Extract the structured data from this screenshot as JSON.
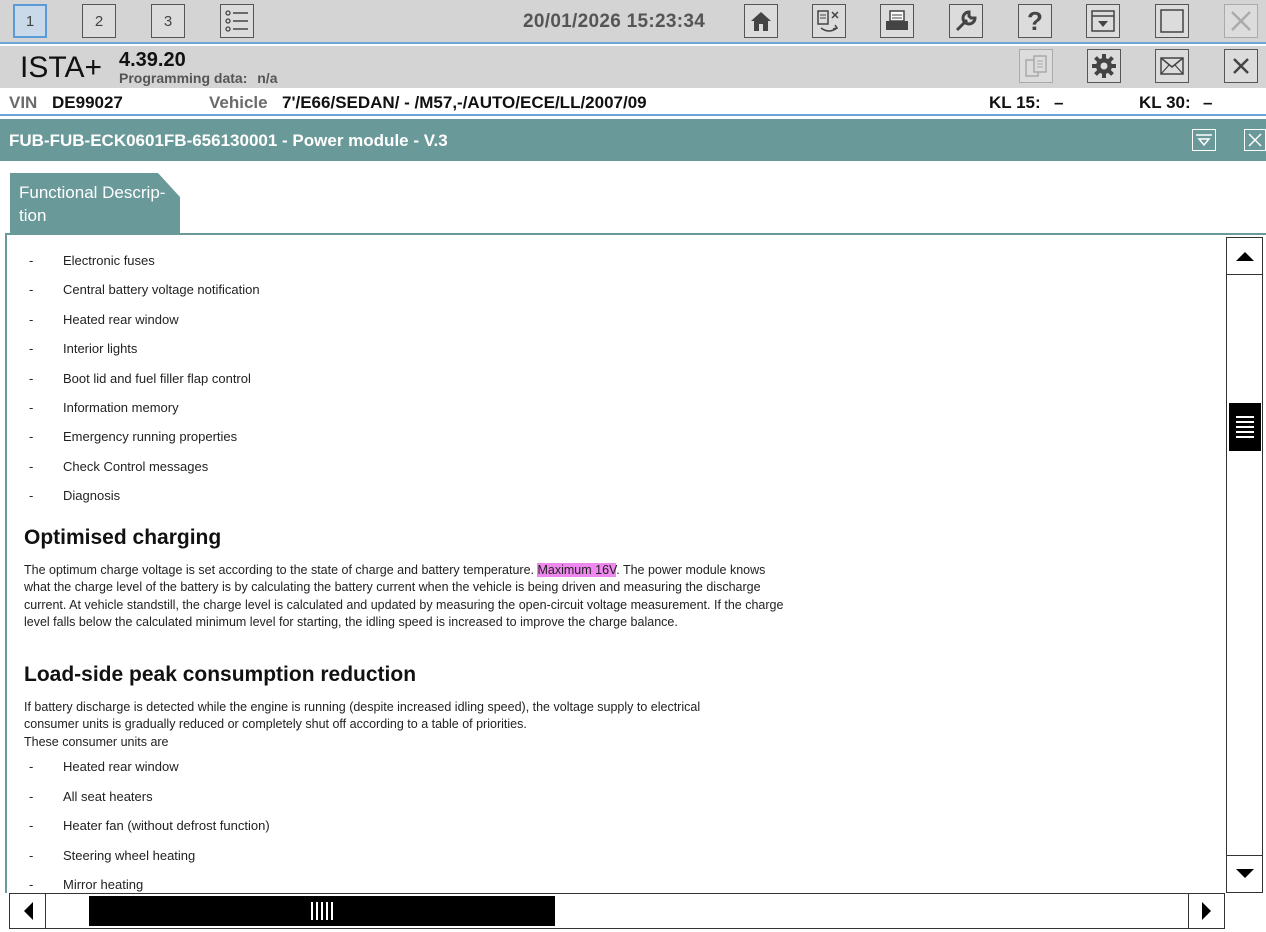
{
  "toolbar": {
    "tabs": [
      "1",
      "2",
      "3"
    ],
    "datetime": "20/01/2026 15:23:34",
    "icons": [
      "list-icon",
      "home-icon",
      "transfer-icon",
      "print-icon",
      "wrench-icon",
      "help-icon",
      "download-icon",
      "window-icon",
      "close-icon"
    ]
  },
  "app": {
    "name": "ISTA+",
    "version": "4.39.20",
    "programming_label": "Programming data:",
    "programming_value": "n/a"
  },
  "vehicle": {
    "vin_label": "VIN",
    "vin_value": "DE99027",
    "vehicle_label": "Vehicle",
    "vehicle_value": "7'/E66/SEDAN/ - /M57,-/AUTO/ECE/LL/2007/09",
    "kl15_label": "KL 15:",
    "kl15_value": "–",
    "kl30_label": "KL 30:",
    "kl30_value": "–"
  },
  "document": {
    "title": "FUB-FUB-ECK0601FB-656130001 - Power module - V.3",
    "tab_label": "Functional Descrip- tion",
    "list1": [
      "Electronic fuses",
      "Central battery voltage notification",
      "Heated rear window",
      "Interior lights",
      "Boot lid and fuel filler flap control",
      "Information memory",
      "Emergency running properties",
      "Check Control messages",
      "Diagnosis"
    ],
    "heading1": "Optimised charging",
    "para1_before": "The optimum charge voltage is set according to the state of charge and battery temperature. ",
    "para1_highlight": "Maximum 16V",
    "para1_after": ". The power module knows what the charge level of the battery is by calculating the battery current when the vehicle is being driven and measuring the discharge current. At vehicle standstill, the charge level is calculated and updated by measuring the open-circuit voltage measurement. If the charge level falls below the calculated minimum level for starting, the idling speed is increased to improve the charge balance.",
    "heading2": "Load-side peak consumption reduction",
    "para2": "If battery discharge is detected while the engine is running (despite increased idling speed), the voltage supply to electrical consumer units is gradually reduced or completely shut off according to a table of priorities.",
    "para2_line2": "These consumer units are",
    "list2": [
      "Heated rear window",
      "All seat heaters",
      "Heater fan (without defrost function)",
      "Steering wheel heating",
      "Mirror heating"
    ],
    "dash": "-"
  }
}
